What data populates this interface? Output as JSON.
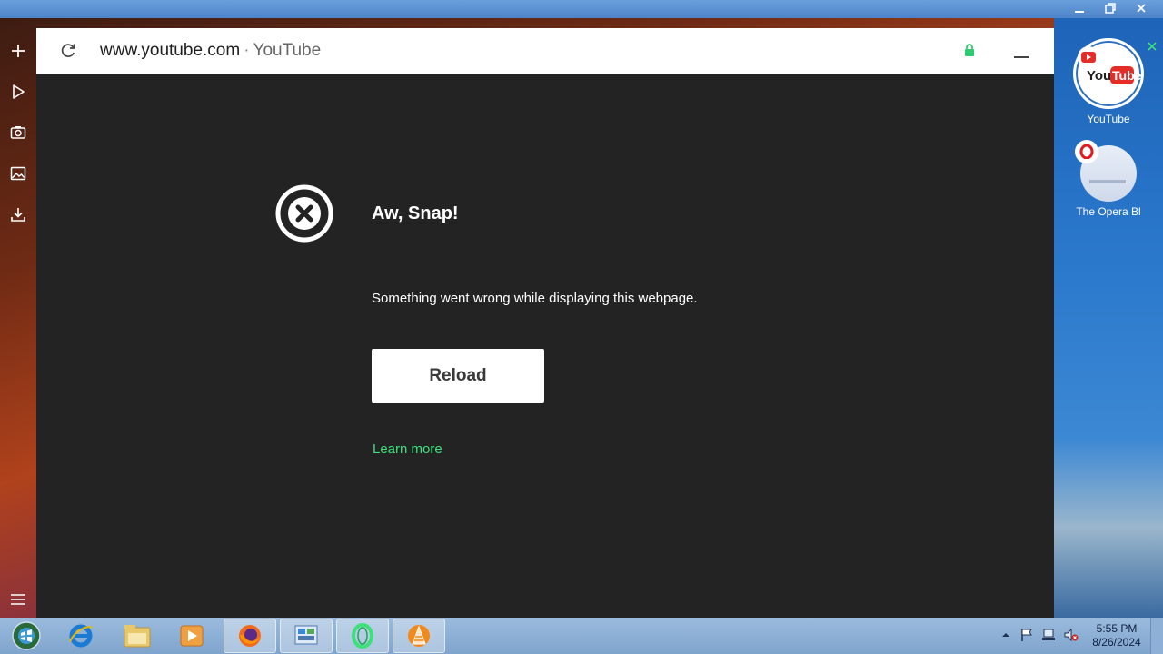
{
  "window": {
    "controls": [
      "minimize",
      "restore",
      "close"
    ]
  },
  "sidebar": {
    "icons": [
      "plus-icon",
      "play-icon",
      "camera-icon",
      "image-icon",
      "download-icon",
      "menu-icon"
    ]
  },
  "address_bar": {
    "url": "www.youtube.com",
    "separator": "·",
    "site_name": "YouTube"
  },
  "error_page": {
    "title": "Aw, Snap!",
    "message": "Something went wrong while displaying this webpage.",
    "reload_label": "Reload",
    "learn_more_label": "Learn more",
    "link_color": "#3ee07a"
  },
  "pinned_sites": [
    {
      "label": "YouTube"
    },
    {
      "label": "The Opera Bl"
    }
  ],
  "taskbar": {
    "apps": [
      "start-orb-icon",
      "internet-explorer-icon",
      "file-explorer-icon",
      "media-player-icon",
      "firefox-icon",
      "control-panel-icon",
      "opera-gx-icon",
      "vlc-icon"
    ],
    "clock_time": "5:55 PM",
    "clock_date": "8/26/2024"
  }
}
